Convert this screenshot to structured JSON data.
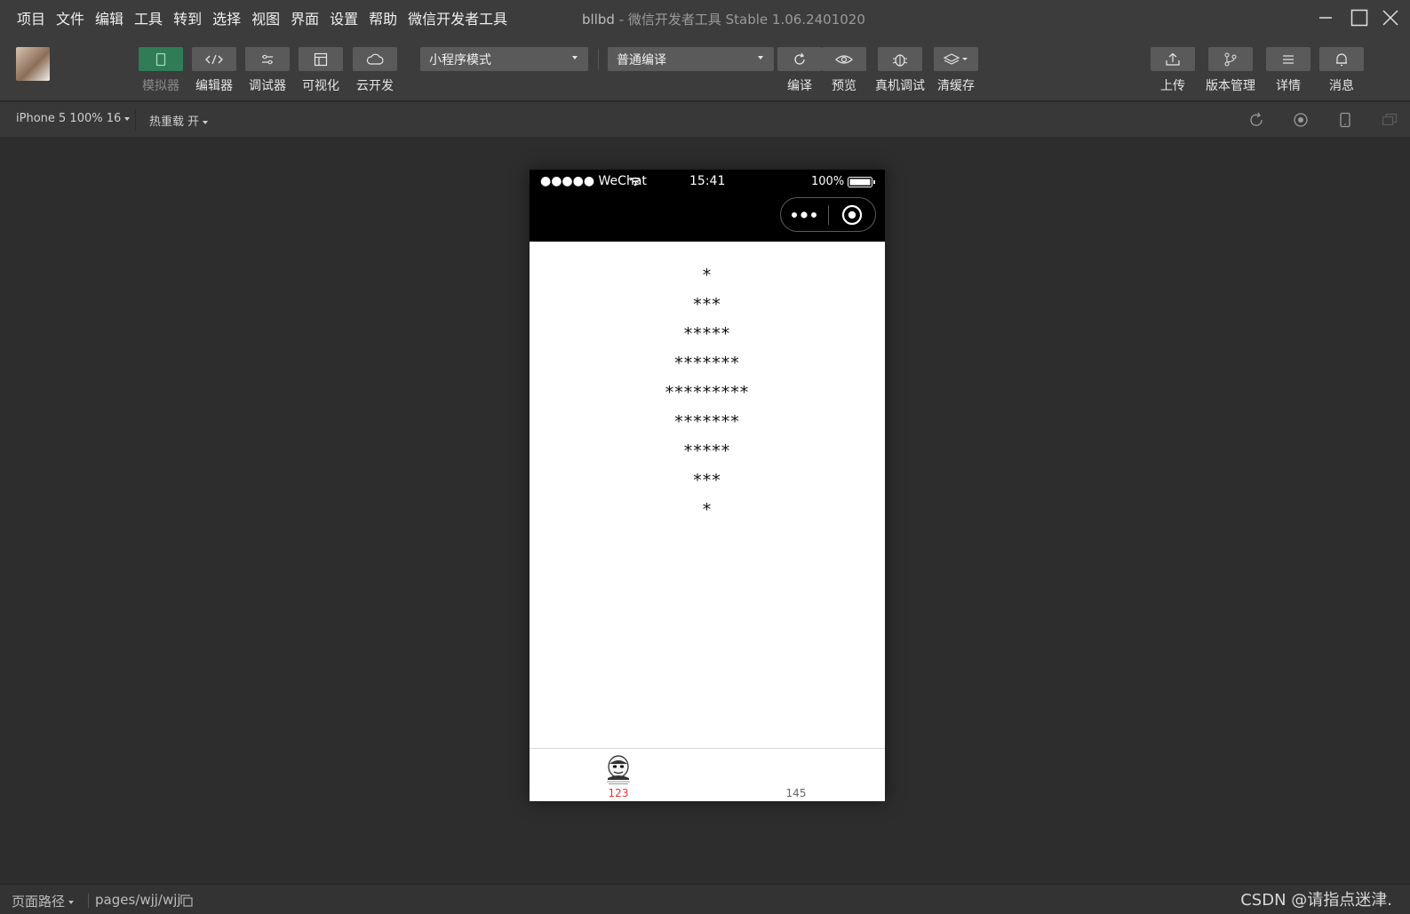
{
  "menu": {
    "items": [
      "项目",
      "文件",
      "编辑",
      "工具",
      "转到",
      "选择",
      "视图",
      "界面",
      "设置",
      "帮助",
      "微信开发者工具"
    ]
  },
  "window": {
    "project": "bllbd",
    "separator": " - ",
    "app_title": "微信开发者工具 Stable 1.06.2401020"
  },
  "toolbar": {
    "simulator_label": "模拟器",
    "editor_label": "编辑器",
    "debugger_label": "调试器",
    "visual_label": "可视化",
    "cloud_label": "云开发",
    "mode_select": "小程序模式",
    "compile_select": "普通编译",
    "compile_label": "编译",
    "preview_label": "预览",
    "real_debug_label": "真机调试",
    "clear_cache_label": "清缓存",
    "upload_label": "上传",
    "version_label": "版本管理",
    "details_label": "详情",
    "messages_label": "消息"
  },
  "subbar": {
    "device": "iPhone 5 100% 16",
    "hot_reload": "热重载 开"
  },
  "phone": {
    "status": {
      "carrier": "●●●●● WeChat",
      "time": "15:41",
      "battery": "100%"
    },
    "content_lines": [
      "*",
      "***",
      "*****",
      "*******",
      "*********",
      "*******",
      "*****",
      "***",
      "*"
    ],
    "tabs": [
      {
        "label": "123",
        "active": true
      },
      {
        "label": "145",
        "active": false
      }
    ]
  },
  "bottom": {
    "path_label": "页面路径",
    "path_value": "pages/wjj/wjj"
  },
  "watermark": "CSDN @请指点迷津.",
  "colors": {
    "accent_green": "#2f7c56",
    "tab_active": "#e8362d"
  }
}
